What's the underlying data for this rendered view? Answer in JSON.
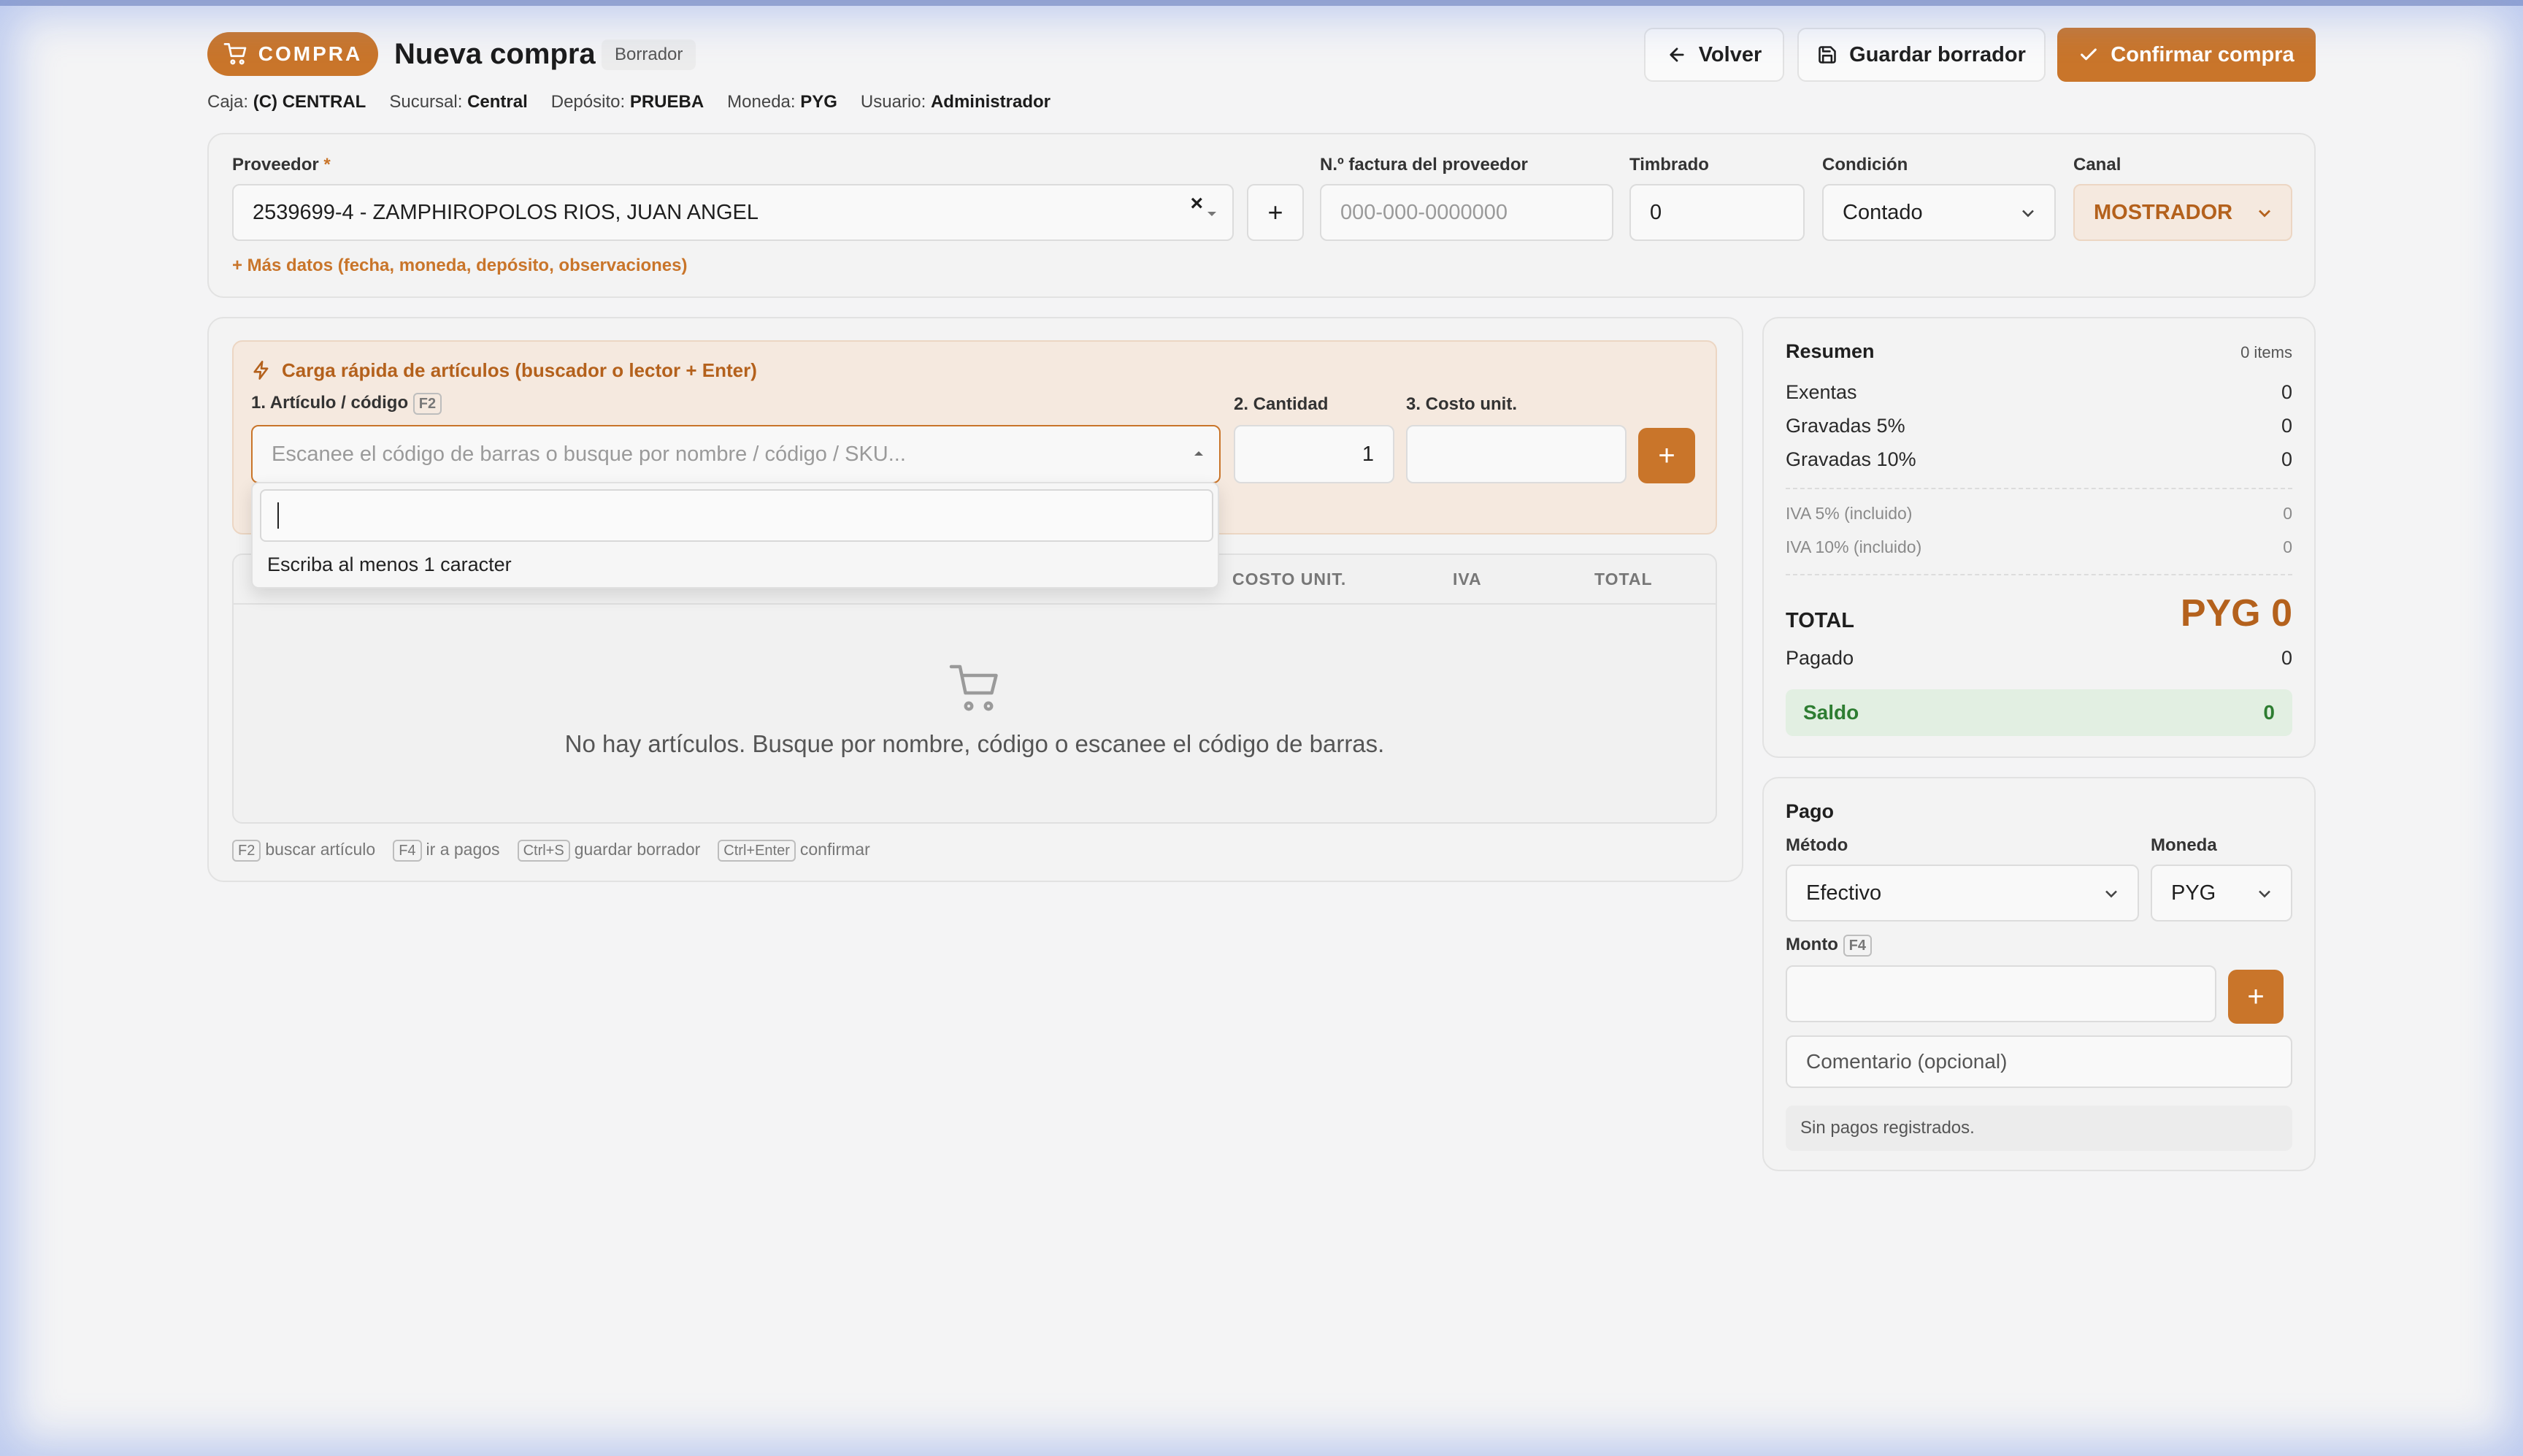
{
  "header": {
    "badge_label": "COMPRA",
    "title": "Nueva compra",
    "status_badge": "Borrador",
    "back_label": "Volver",
    "save_draft_label": "Guardar borrador",
    "confirm_label": "Confirmar compra"
  },
  "info": {
    "caja_label": "Caja:",
    "caja_value": "(C) CENTRAL",
    "sucursal_label": "Sucursal:",
    "sucursal_value": "Central",
    "deposito_label": "Depósito:",
    "deposito_value": "PRUEBA",
    "moneda_label": "Moneda:",
    "moneda_value": "PYG",
    "usuario_label": "Usuario:",
    "usuario_value": "Administrador"
  },
  "supplier": {
    "proveedor_label": "Proveedor",
    "required_mark": "*",
    "proveedor_value": "2539699-4 - ZAMPHIROPOLOS RIOS, JUAN ANGEL",
    "clear_glyph": "×",
    "add_glyph": "+",
    "factura_label": "N.º factura del proveedor",
    "factura_placeholder": "000-000-0000000",
    "timbrado_label": "Timbrado",
    "timbrado_value": "0",
    "condicion_label": "Condición",
    "condicion_value": "Contado",
    "canal_label": "Canal",
    "canal_value": "MOSTRADOR",
    "more_data_link": "+ Más datos (fecha, moneda, depósito, observaciones)"
  },
  "quick_load": {
    "title": "Carga rápida de artículos (buscador o lector + Enter)",
    "article_label": "1. Artículo / código",
    "article_key": "F2",
    "article_placeholder": "Escanee el código de barras o busque por nombre / código / SKU...",
    "qty_label": "2. Cantidad",
    "qty_value": "1",
    "cost_label": "3. Costo unit.",
    "add_glyph": "+",
    "dropdown_hint": "Escriba al menos 1 caracter"
  },
  "table": {
    "columns": [
      "COSTO UNIT.",
      "IVA",
      "TOTAL"
    ],
    "empty_text": "No hay artículos. Busque por nombre, código o escanee el código de barras."
  },
  "shortcuts": [
    {
      "key": "F2",
      "text": "buscar artículo"
    },
    {
      "key": "F4",
      "text": "ir a pagos"
    },
    {
      "key": "Ctrl+S",
      "text": "guardar borrador"
    },
    {
      "key": "Ctrl+Enter",
      "text": "confirmar"
    }
  ],
  "summary": {
    "title": "Resumen",
    "items_count": "0 items",
    "exentas_label": "Exentas",
    "exentas_value": "0",
    "grav5_label": "Gravadas 5%",
    "grav5_value": "0",
    "grav10_label": "Gravadas 10%",
    "grav10_value": "0",
    "iva5_label": "IVA 5% (incluido)",
    "iva5_value": "0",
    "iva10_label": "IVA 10% (incluido)",
    "iva10_value": "0",
    "total_label": "TOTAL",
    "total_value": "PYG 0",
    "pagado_label": "Pagado",
    "pagado_value": "0",
    "saldo_label": "Saldo",
    "saldo_value": "0"
  },
  "payment": {
    "title": "Pago",
    "metodo_label": "Método",
    "metodo_value": "Efectivo",
    "moneda_label": "Moneda",
    "moneda_value": "PYG",
    "monto_label": "Monto",
    "monto_key": "F4",
    "add_glyph": "+",
    "comment_placeholder": "Comentario (opcional)",
    "no_payments": "Sin pagos registrados."
  },
  "colors": {
    "accent": "#c9752a",
    "accent_dark": "#b4611c",
    "saldo_bg": "#e2efe2",
    "saldo_text": "#2e7d32",
    "quick_bg": "#f5e9df"
  }
}
